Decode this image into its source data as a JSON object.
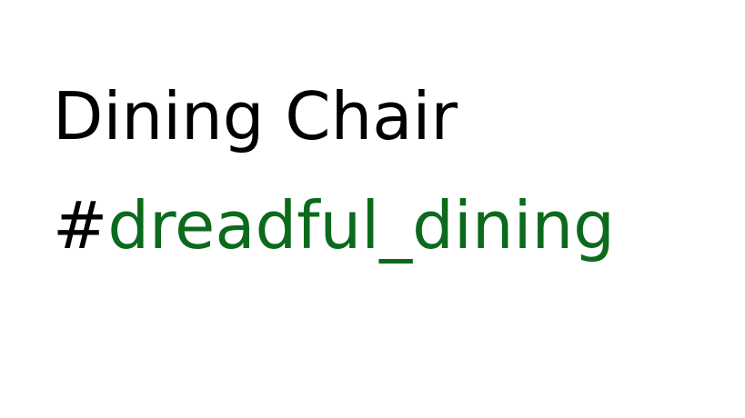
{
  "title": "Dining Chair",
  "hashtag": {
    "symbol": "#",
    "text": "dreadful_dining"
  },
  "colors": {
    "background": "#ffffff",
    "title_text": "#000000",
    "hash_symbol": "#000000",
    "hashtag_text": "#0b6a1b"
  }
}
